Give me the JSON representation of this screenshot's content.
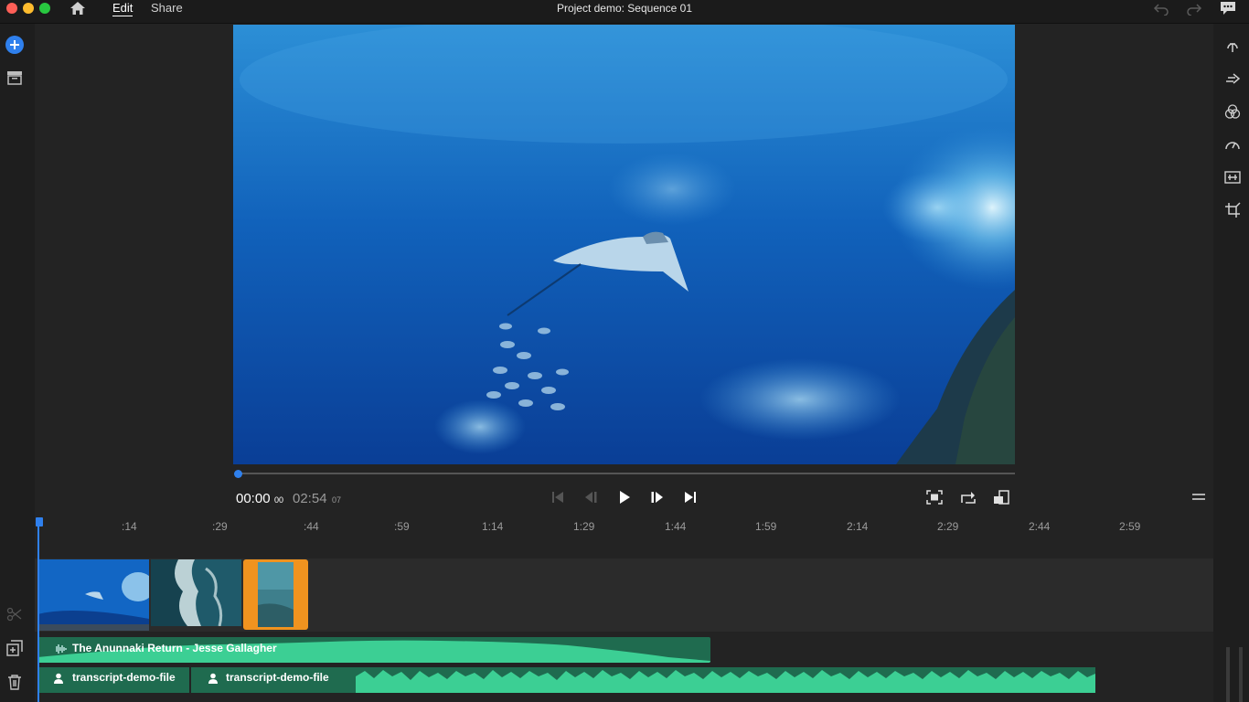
{
  "titlebar": {
    "title": "Project demo: Sequence 01",
    "menu_edit": "Edit",
    "menu_share": "Share"
  },
  "monitor": {
    "current_time": "00:00",
    "current_frames": "00",
    "total_time": "02:54",
    "total_frames": "07",
    "playhead_fraction": 0
  },
  "timeline": {
    "ticks": [
      ":14",
      ":29",
      ":44",
      ":59",
      "1:14",
      "1:29",
      "1:44",
      "1:59",
      "2:14",
      "2:29",
      "2:44",
      "2:59"
    ],
    "music_clip": "The Anunnaki Return - Jesse Gallagher",
    "voice_clips": [
      "transcript-demo-file",
      "transcript-demo-file"
    ]
  },
  "colors": {
    "accent": "#2f80ed",
    "selected_clip": "#f0931f",
    "audio_clip": "#1f6b4f",
    "waveform": "#3ccf94"
  },
  "icons": {
    "titlebar": [
      "home-icon",
      "undo-icon",
      "redo-icon",
      "comment-icon"
    ],
    "left_rail": [
      "add-icon",
      "media-icon",
      "razor-icon",
      "duplicate-icon",
      "trash-icon"
    ],
    "right_rail": [
      "titles-icon",
      "transitions-icon",
      "color-icon",
      "speed-icon",
      "audio-icon",
      "crop-icon"
    ],
    "transport": [
      "skip-to-start-icon",
      "step-back-icon",
      "play-icon",
      "step-forward-icon",
      "skip-to-end-icon"
    ],
    "monitor": [
      "fit-icon",
      "loop-icon",
      "aspect-icon",
      "menu-icon"
    ]
  }
}
